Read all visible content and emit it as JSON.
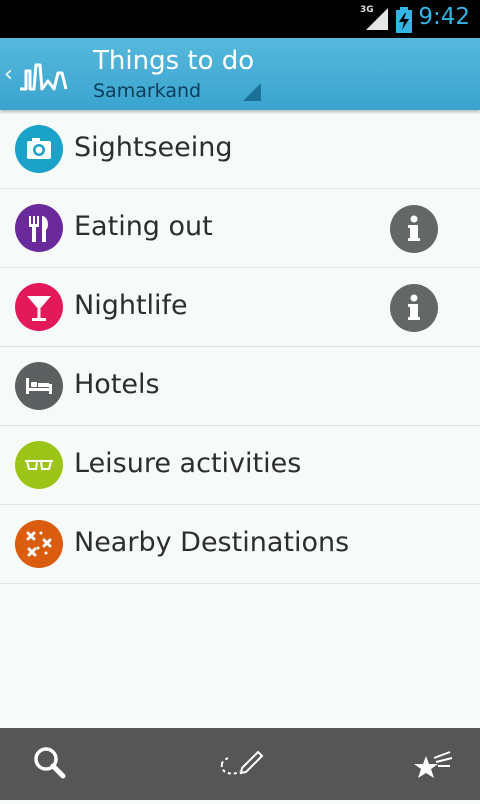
{
  "status_bar": {
    "network": "3G",
    "time": "9:42"
  },
  "header": {
    "title": "Things to do",
    "subtitle": "Samarkand",
    "up_icon": "chevron-left-icon",
    "logo_icon": "city-skyline-logo"
  },
  "categories": [
    {
      "label": "Sightseeing",
      "icon": "camera-icon",
      "color": "#1ba2c8",
      "info": false
    },
    {
      "label": "Eating out",
      "icon": "fork-knife-icon",
      "color": "#6a2a9c",
      "info": true
    },
    {
      "label": "Nightlife",
      "icon": "cocktail-glass-icon",
      "color": "#e3195a",
      "info": true
    },
    {
      "label": "Hotels",
      "icon": "bed-icon",
      "color": "#5c6060",
      "info": false
    },
    {
      "label": "Leisure activities",
      "icon": "sunglasses-icon",
      "color": "#9cc417",
      "info": false
    },
    {
      "label": "Nearby Destinations",
      "icon": "map-route-icon",
      "color": "#d95c0f",
      "info": false
    }
  ],
  "bottom_bar": {
    "items": [
      "search-icon",
      "route-pen-icon",
      "starred-icon"
    ]
  }
}
